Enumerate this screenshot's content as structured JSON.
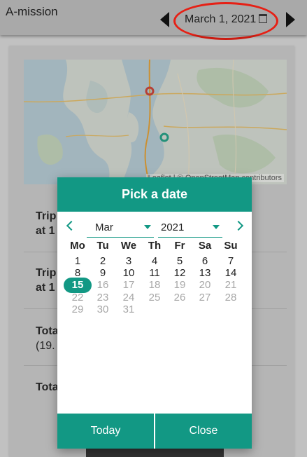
{
  "header": {
    "app_title": "A-mission",
    "date": "March 1, 2021",
    "icons": [
      "chevron-left-icon",
      "calendar-icon",
      "chevron-right-icon"
    ]
  },
  "map": {
    "attribution": "Leaflet | © OpenStreetMap contributors"
  },
  "background_rows": [
    {
      "label": "Trip",
      "sub": "at 1"
    },
    {
      "label": "Trip",
      "sub": "at 1"
    },
    {
      "label": "Tota",
      "sub": "(19."
    },
    {
      "label": "Tota"
    }
  ],
  "picker": {
    "title": "Pick a date",
    "month": "Mar",
    "year": "2021",
    "weekdays": [
      "Mo",
      "Tu",
      "We",
      "Th",
      "Fr",
      "Sa",
      "Su"
    ],
    "weeks": [
      [
        "1",
        "2",
        "3",
        "4",
        "5",
        "6",
        "7"
      ],
      [
        "8",
        "9",
        "10",
        "11",
        "12",
        "13",
        "14"
      ],
      [
        "15",
        "16",
        "17",
        "18",
        "19",
        "20",
        "21"
      ],
      [
        "22",
        "23",
        "24",
        "25",
        "26",
        "27",
        "28"
      ],
      [
        "29",
        "30",
        "31"
      ]
    ],
    "selected_day": "15",
    "today_label": "Today",
    "close_label": "Close"
  },
  "colors": {
    "accent": "#129884",
    "highlight_ring": "#e62015"
  }
}
